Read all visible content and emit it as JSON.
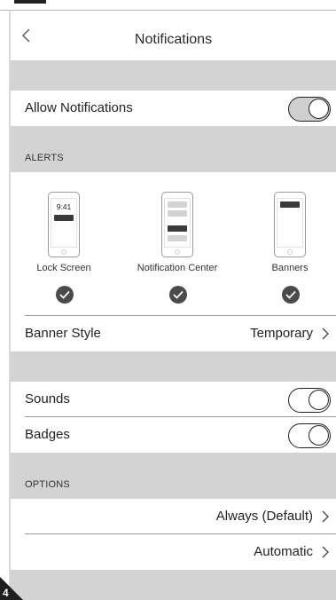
{
  "nav": {
    "title": "Notifications",
    "back_icon": "chevron-left-icon"
  },
  "allow": {
    "label": "Allow Notifications",
    "on": true
  },
  "alerts": {
    "section_label": "ALERTS",
    "lock_time": "9:41",
    "items": [
      {
        "label": "Lock Screen",
        "checked": true
      },
      {
        "label": "Notification Center",
        "checked": true
      },
      {
        "label": "Banners",
        "checked": true
      }
    ]
  },
  "banner_style": {
    "label": "Banner Style",
    "value": "Temporary"
  },
  "sounds": {
    "label": "Sounds",
    "on": false
  },
  "badges": {
    "label": "Badges",
    "on": false
  },
  "options": {
    "section_label": "OPTIONS",
    "preview_value": "Always (Default)",
    "grouping_value": "Automatic"
  },
  "corner_badge": "4",
  "colors": {
    "section_gray": "#d3d3d3",
    "check": "#4b4b4b",
    "toggle_on": "#cfcfcf"
  }
}
